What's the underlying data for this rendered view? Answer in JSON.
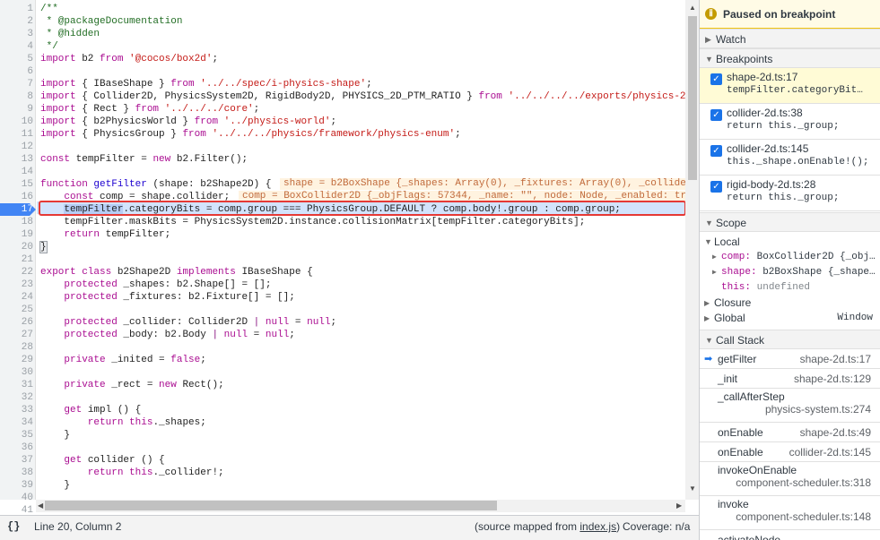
{
  "editor": {
    "lines": [
      {
        "n": "1"
      },
      {
        "n": "2"
      },
      {
        "n": "3"
      },
      {
        "n": "4"
      },
      {
        "n": "5"
      },
      {
        "n": "6"
      },
      {
        "n": "7"
      },
      {
        "n": "8"
      },
      {
        "n": "9"
      },
      {
        "n": "10"
      },
      {
        "n": "11"
      },
      {
        "n": "12"
      },
      {
        "n": "13"
      },
      {
        "n": "14"
      },
      {
        "n": "15"
      },
      {
        "n": "16"
      },
      {
        "n": "17"
      },
      {
        "n": "18"
      },
      {
        "n": "19"
      },
      {
        "n": "20"
      },
      {
        "n": "21"
      },
      {
        "n": "22"
      },
      {
        "n": "23"
      },
      {
        "n": "24"
      },
      {
        "n": "25"
      },
      {
        "n": "26"
      },
      {
        "n": "27"
      },
      {
        "n": "28"
      },
      {
        "n": "29"
      },
      {
        "n": "30"
      },
      {
        "n": "31"
      },
      {
        "n": "32"
      },
      {
        "n": "33"
      },
      {
        "n": "34"
      },
      {
        "n": "35"
      },
      {
        "n": "36"
      },
      {
        "n": "37"
      },
      {
        "n": "38"
      },
      {
        "n": "39"
      },
      {
        "n": "40"
      },
      {
        "n": "41"
      }
    ],
    "code": {
      "l1": "/**",
      "l2": " * @packageDocumentation",
      "l3": " * @hidden",
      "l4": " */",
      "l5a": "import",
      "l5b": " b2 ",
      "l5c": "from",
      "l5d": " '@cocos/box2d'",
      ";": ";",
      "l7a": "import",
      "l7b": " { IBaseShape } ",
      "l7c": "from",
      "l7d": " '../../spec/i-physics-shape'",
      "l7e": ";",
      "l8a": "import",
      "l8b": " { Collider2D, PhysicsSystem2D, RigidBody2D, PHYSICS_2D_PTM_RATIO } ",
      "l8c": "from",
      "l8d": " '../../../../exports/physics-2",
      "l9a": "import",
      "l9b": " { Rect } ",
      "l9c": "from",
      "l9d": " '../../../core'",
      "l9e": ";",
      "l10a": "import",
      "l10b": " { b2PhysicsWorld } ",
      "l10c": "from",
      "l10d": " '../physics-world'",
      "l10e": ";",
      "l11a": "import",
      "l11b": " { PhysicsGroup } ",
      "l11c": "from",
      "l11d": " '../../../physics/framework/physics-enum'",
      "l11e": ";",
      "l13a": "const",
      "l13b": " tempFilter = ",
      "l13c": "new",
      "l13d": " b2.Filter();",
      "l15a": "function",
      "l15b": " getFilter",
      "l15c": " (shape: b2Shape2D) {",
      "l16a": "    const",
      "l16b": " comp = shape.collider;",
      "l17a": "    ",
      "l17b": "tempFilter",
      "l17c": ".categoryBits = comp.group === PhysicsGroup.DEFAULT ? comp.body!.group : comp.group;",
      "l18": "    tempFilter.maskBits = PhysicsSystem2D.instance.collisionMatrix[tempFilter.categoryBits];",
      "l19a": "    return",
      "l19b": " tempFilter;",
      "l20": "}",
      "l22a": "export class",
      "l22b": " b2Shape2D ",
      "l22c": "implements",
      "l22d": " IBaseShape {",
      "l23a": "    protected",
      "l23b": " _shapes: b2.Shape[] = [];",
      "l24a": "    protected",
      "l24b": " _fixtures: b2.Fixture[] = [];",
      "l26a": "    protected",
      "l26b": " _collider: Collider2D ",
      "l26c": "|",
      "l26d": " null",
      "l26e": " = ",
      "l26f": "null",
      ";26": ";",
      "l27a": "    protected",
      "l27b": " _body: b2.Body ",
      "l27c": "|",
      "l27d": " null",
      "l27e": " = ",
      "l27f": "null",
      "l29a": "    private",
      "l29b": " _inited = ",
      "l29c": "false",
      "l31a": "    private",
      "l31b": " _rect = ",
      "l31c": "new",
      "l31d": " Rect();",
      "l33a": "    get",
      "l33b": " impl () {",
      "l34a": "        return",
      "l34b": " this",
      "l34c": "._shapes;",
      "l35": "    }",
      "l37a": "    get",
      "l37b": " collider () {",
      "l38a": "        return",
      "l38b": " this",
      "l38c": "._collider!;",
      "l39": "    }"
    },
    "hint15": "shape = b2BoxShape {_shapes: Array(0), _fixtures: Array(0), _collide",
    "hint16": "comp = BoxCollider2D {_objFlags: 57344, _name: \"\", node: Node, _enabled: tr"
  },
  "status": {
    "braces": "{}",
    "position": "Line 20, Column 2",
    "mapped_prefix": "(source mapped from ",
    "mapped_file": "index.js",
    "mapped_suffix": ")",
    "coverage": "Coverage: n/a"
  },
  "panel": {
    "paused": "Paused on breakpoint",
    "watch": "Watch",
    "breakpoints_title": "Breakpoints",
    "breakpoints": [
      {
        "file": "shape-2d.ts:17",
        "src": "tempFilter.categoryBit…"
      },
      {
        "file": "collider-2d.ts:38",
        "src": "return this._group;"
      },
      {
        "file": "collider-2d.ts:145",
        "src": "this._shape.onEnable!();"
      },
      {
        "file": "rigid-body-2d.ts:28",
        "src": "return this._group;"
      }
    ],
    "scope_title": "Scope",
    "local": "Local",
    "comp_key": "comp:",
    "comp_val": " BoxCollider2D {_obj…",
    "shape_key": "shape:",
    "shape_val": " b2BoxShape {_shape…",
    "this_key": "this:",
    "this_val": " undefined",
    "closure": "Closure",
    "global": "Global",
    "window": "Window",
    "callstack_title": "Call Stack",
    "frames": [
      {
        "name": "getFilter",
        "loc": "shape-2d.ts:17"
      },
      {
        "name": "_init",
        "loc": "shape-2d.ts:129"
      },
      {
        "name": "_callAfterStep",
        "loc": "physics-system.ts:274"
      },
      {
        "name": "onEnable",
        "loc": "shape-2d.ts:49"
      },
      {
        "name": "onEnable",
        "loc": "collider-2d.ts:145"
      },
      {
        "name": "invokeOnEnable",
        "loc": "component-scheduler.ts:318"
      },
      {
        "name": "invoke",
        "loc": "component-scheduler.ts:148"
      },
      {
        "name": "activateNode",
        "loc": ""
      }
    ]
  },
  "colors": {
    "breakpoint": "#4285f4",
    "highlight": "#d2e3fc",
    "redbox": "#e53935",
    "paused_bg": "#fffbe6"
  }
}
